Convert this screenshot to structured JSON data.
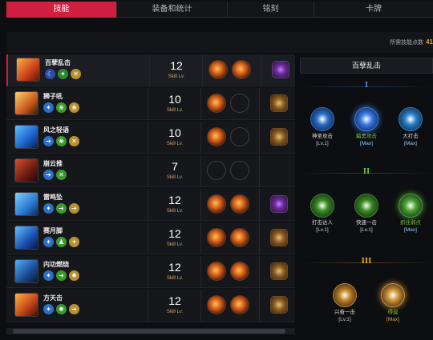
{
  "tabs": [
    {
      "label": "技能"
    },
    {
      "label": "装备和统计"
    },
    {
      "label": "铭刻"
    },
    {
      "label": "卡牌"
    }
  ],
  "points": {
    "label": "所需技能点数",
    "value": "41"
  },
  "skills": [
    {
      "name": "百孽乱击",
      "level": "12",
      "level_label": "Skill Lv.",
      "gems": [
        "full",
        "full"
      ],
      "stone": "purple"
    },
    {
      "name": "狮子吼",
      "level": "10",
      "level_label": "Skill Lv.",
      "gems": [
        "full",
        "empty"
      ],
      "stone": "gold"
    },
    {
      "name": "风之轻语",
      "level": "10",
      "level_label": "Skill Lv.",
      "gems": [
        "full",
        "empty"
      ],
      "stone": "gold"
    },
    {
      "name": "崩云推",
      "level": "7",
      "level_label": "Skill Lv.",
      "gems": [
        "empty",
        "empty"
      ],
      "stone": ""
    },
    {
      "name": "雷鸣坠",
      "level": "12",
      "level_label": "Skill Lv.",
      "gems": [
        "full",
        "full"
      ],
      "stone": "purple"
    },
    {
      "name": "赛月脚",
      "level": "12",
      "level_label": "Skill Lv.",
      "gems": [
        "full",
        "full"
      ],
      "stone": "gold"
    },
    {
      "name": "内功燃烧",
      "level": "12",
      "level_label": "Skill Lv.",
      "gems": [
        "full",
        "full"
      ],
      "stone": "gold"
    },
    {
      "name": "方天击",
      "level": "12",
      "level_label": "Skill Lv.",
      "gems": [
        "full",
        "full"
      ],
      "stone": "gold"
    }
  ],
  "tripod_panel": {
    "title": "百孽乱击",
    "tiers": [
      {
        "numeral": "I",
        "color": "#4a8fd8",
        "nodes": [
          {
            "name": "神圣攻击",
            "level": "[Lv.1]",
            "icon": "holy-burst-icon",
            "color": "#2a6fc8",
            "state": "normal"
          },
          {
            "name": "黯黑攻击",
            "level": "[Max]",
            "icon": "dark-moon-icon",
            "color": "#3a7ae8",
            "state": "selected"
          },
          {
            "name": "大打击",
            "level": "[Max]",
            "icon": "big-strike-icon",
            "color": "#2a80c8",
            "state": "normal"
          }
        ]
      },
      {
        "numeral": "II",
        "color": "#6ac030",
        "nodes": [
          {
            "name": "打击达人",
            "level": "[Lv.1]",
            "icon": "strike-master-icon",
            "color": "#3a8a20",
            "state": "normal"
          },
          {
            "name": "快速一击",
            "level": "[Lv.1]",
            "icon": "quick-strike-icon",
            "color": "#3a8a20",
            "state": "normal"
          },
          {
            "name": "抓住弱点",
            "level": "[Max]",
            "icon": "weakpoint-icon",
            "color": "#4aa030",
            "state": "selected"
          }
        ]
      },
      {
        "numeral": "III",
        "color": "#e0a830",
        "nodes": [
          {
            "name": "兴奋一击",
            "level": "[Lv.1]",
            "icon": "excite-strike-icon",
            "color": "#c08020",
            "state": "normal"
          },
          {
            "name": "得逞",
            "level": "[Max]",
            "icon": "crossed-swords-icon",
            "color": "#d09030",
            "state": "selected"
          }
        ]
      }
    ]
  },
  "colors": {
    "accent": "#d11f3f",
    "gold": "#e0a830"
  }
}
